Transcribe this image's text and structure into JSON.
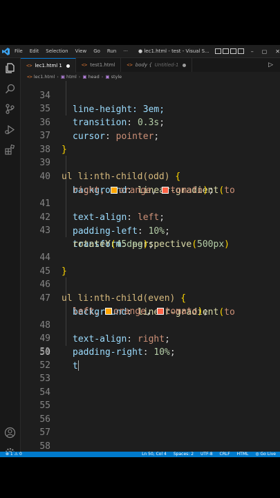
{
  "titlebar": {
    "menus": [
      "File",
      "Edit",
      "Selection",
      "View",
      "Go",
      "Run",
      "···"
    ],
    "title": "● lec1.html - test - Visual S...",
    "controls": [
      "–",
      "▢",
      "✕"
    ]
  },
  "tabs": [
    {
      "label": "lec1.html 1",
      "active": true,
      "modified": true
    },
    {
      "label": "test1.html",
      "active": false,
      "modified": false
    },
    {
      "label": "body {",
      "suffix": "Untitled-1",
      "active": false,
      "modified": true
    }
  ],
  "breadcrumb": [
    "lec1.html",
    "html",
    "head",
    "style"
  ],
  "code": {
    "lines": [
      {
        "n": "34",
        "text": "line-height: 3em;"
      },
      {
        "n": "35",
        "prop": "transition",
        "value": "0.3s"
      },
      {
        "n": "36",
        "prop": "cursor",
        "value": "pointer"
      },
      {
        "n": "37",
        "text": "}"
      },
      {
        "n": "38",
        "text": ""
      },
      {
        "n": "39",
        "selector": "ul li:nth-child(odd)",
        "brace": "{"
      },
      {
        "n": "40",
        "prop": "background",
        "fn": "linear-gradient",
        "arg1": "to",
        "wrap_text": "right, ",
        "color1": "orange",
        "color2": "tomato"
      },
      {
        "n": "41",
        "prop": "text-align",
        "value": "left"
      },
      {
        "n": "42",
        "prop": "padding-left",
        "value": "10%"
      },
      {
        "n": "43",
        "prop": "transform",
        "fn": "perspective",
        "arg": "500px",
        "wrap_fn": "rotateY",
        "wrap_arg": "45deg"
      },
      {
        "n": "44",
        "text": "}"
      },
      {
        "n": "45",
        "text": ""
      },
      {
        "n": "46",
        "selector": "ul li:nth-child(even)",
        "brace": "{"
      },
      {
        "n": "47",
        "prop": "background",
        "fn": "linear-gradient",
        "arg1": "to",
        "wrap_text": "left, ",
        "color1": "orange",
        "color2": "tomato"
      },
      {
        "n": "48",
        "prop": "text-align",
        "value": "right"
      },
      {
        "n": "49",
        "prop": "padding-right",
        "value": "10%"
      },
      {
        "n": "50",
        "text": "t",
        "current": true
      },
      {
        "n": "51"
      },
      {
        "n": "52"
      },
      {
        "n": "53"
      },
      {
        "n": "54"
      },
      {
        "n": "55"
      },
      {
        "n": "56"
      },
      {
        "n": "57"
      },
      {
        "n": "58"
      }
    ]
  },
  "swatch_colors": {
    "orange": "#ffa500",
    "tomato": "#ff6347"
  },
  "statusbar": {
    "left": "⊗ 1 ⚠ 0",
    "items": [
      "Ln 50, Col 4",
      "Spaces: 2",
      "UTF-8",
      "CRLF",
      "HTML",
      "◎ Go Live"
    ]
  },
  "colors": {
    "accent": "#007acc",
    "editor_bg": "#1e1e1e"
  }
}
